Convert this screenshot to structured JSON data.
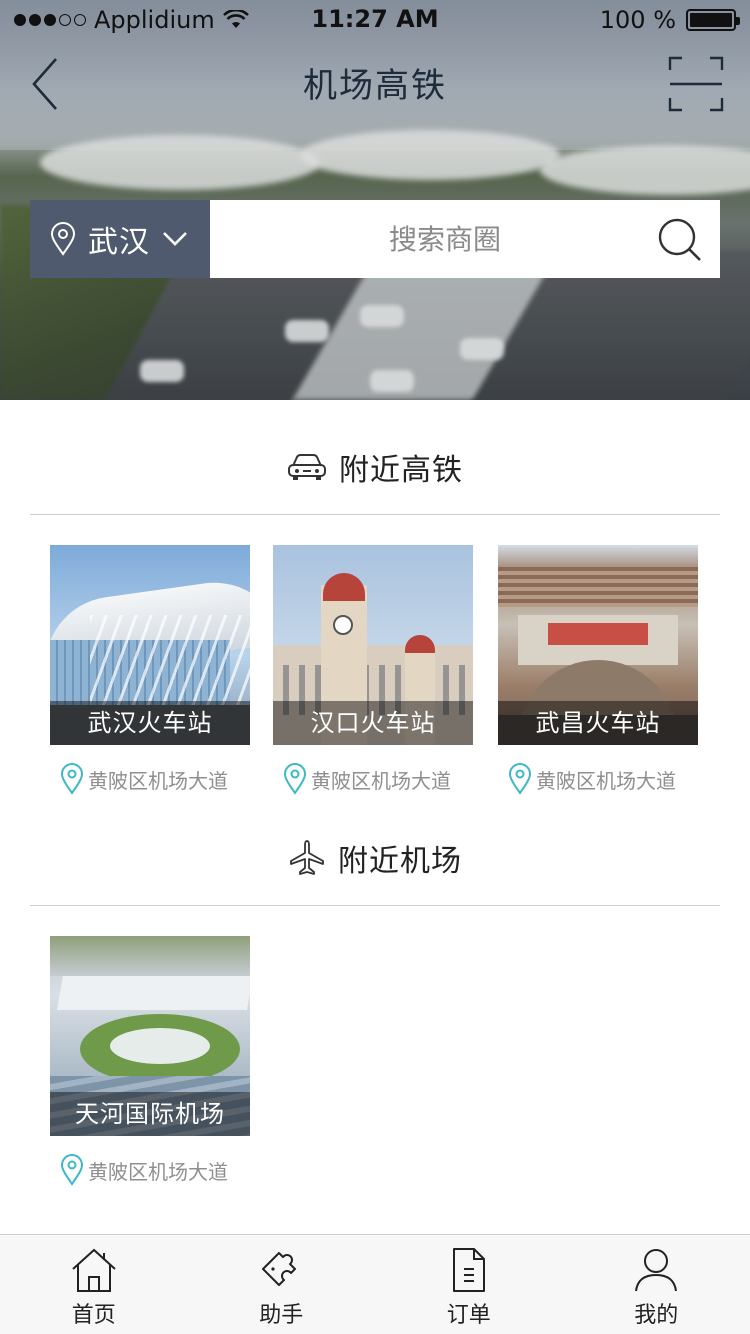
{
  "status_bar": {
    "signal_total": 5,
    "signal_filled": 3,
    "carrier": "Applidium",
    "time": "11:27 AM",
    "battery_text": "100 %",
    "battery_level": 1.0
  },
  "nav": {
    "title": "机场高铁",
    "back_icon": "chevron-left-icon",
    "scan_icon": "scan-frame-icon"
  },
  "search": {
    "city": "武汉",
    "placeholder": "搜索商圈",
    "location_icon": "location-pin-icon",
    "dropdown_icon": "chevron-down-icon",
    "search_icon": "search-icon"
  },
  "sections": {
    "rail": {
      "title": "附近高铁",
      "icon": "car-icon",
      "items": [
        {
          "name": "武汉火车站",
          "address": "黄陂区机场大道"
        },
        {
          "name": "汉口火车站",
          "address": "黄陂区机场大道"
        },
        {
          "name": "武昌火车站",
          "address": "黄陂区机场大道"
        }
      ]
    },
    "airport": {
      "title": "附近机场",
      "icon": "airplane-icon",
      "items": [
        {
          "name": "天河国际机场",
          "address": "黄陂区机场大道"
        }
      ]
    }
  },
  "tabbar": {
    "items": [
      {
        "label": "首页",
        "icon": "home-icon"
      },
      {
        "label": "助手",
        "icon": "puzzle-icon"
      },
      {
        "label": "订单",
        "icon": "document-icon"
      },
      {
        "label": "我的",
        "icon": "user-icon"
      }
    ]
  },
  "colors": {
    "city_select_bg": "#505a6e",
    "accent_teal": "#3cb8c8",
    "title_dark": "#1d2b3a"
  }
}
